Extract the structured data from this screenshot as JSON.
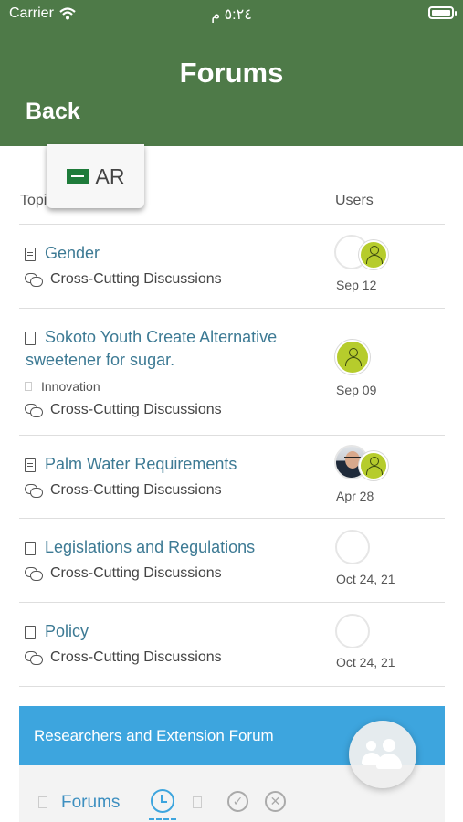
{
  "status_bar": {
    "carrier": "Carrier",
    "time": "٥:٢٤ م"
  },
  "header": {
    "title": "Forums",
    "back_label": "Back"
  },
  "language": {
    "label": "AR"
  },
  "table": {
    "columns": [
      "Topics",
      "Users"
    ],
    "topics": [
      {
        "title": "Gender",
        "category": "Cross-Cutting Discussions",
        "date": "Sep 12",
        "icon": "document-lines-icon"
      },
      {
        "title_line1": "Sokoto Youth Create Alternative",
        "title_line2": "sweetener for sugar.",
        "tag": "Innovation",
        "category": "Cross-Cutting Discussions",
        "date": "Sep 09",
        "icon": "document-icon"
      },
      {
        "title": "Palm Water Requirements",
        "category": "Cross-Cutting Discussions",
        "date": "Apr 28",
        "icon": "document-lines-icon"
      },
      {
        "title": "Legislations and Regulations",
        "category": "Cross-Cutting Discussions",
        "date": "Oct 24, 21",
        "icon": "document-icon"
      },
      {
        "title": "Policy",
        "category": "Cross-Cutting Discussions",
        "date": "Oct 24, 21",
        "icon": "document-icon"
      }
    ]
  },
  "forum_card": {
    "title": "Researchers and Extension Forum"
  },
  "tabs": {
    "forums_label": "Forums"
  },
  "colors": {
    "header_green": "#4e7a48",
    "link_blue": "#3d7a94",
    "banner_blue": "#3da5de",
    "avatar_lime": "#b6cc2c"
  }
}
